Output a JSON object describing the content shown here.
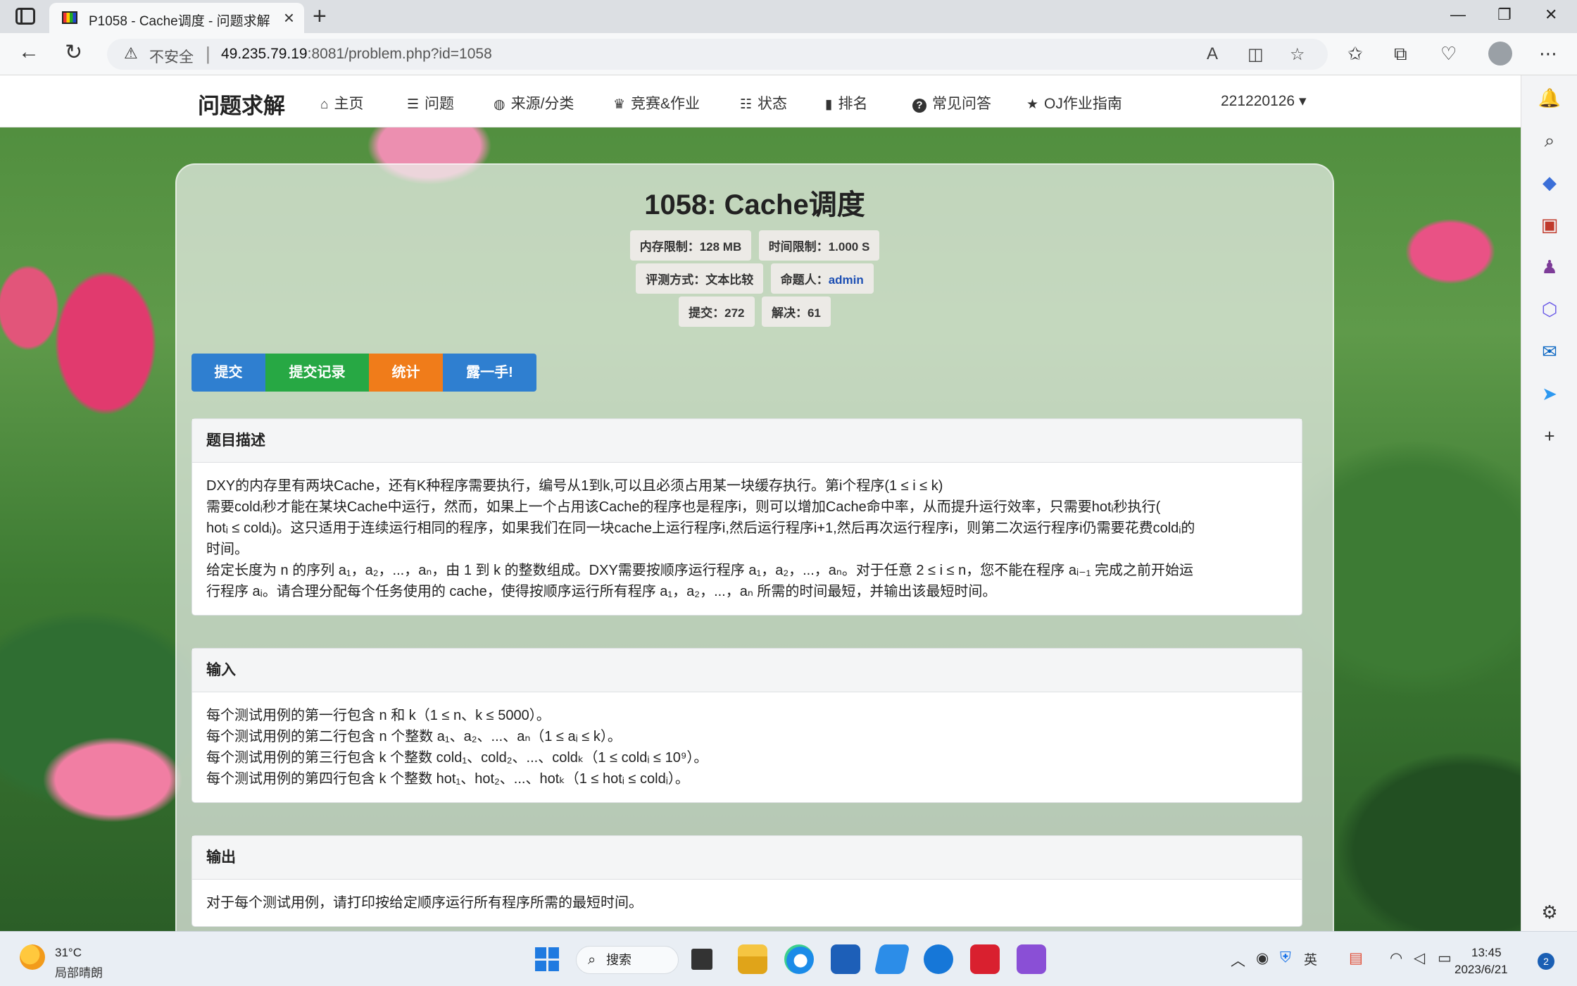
{
  "browser": {
    "tab_title": "P1058 - Cache调度 - 问题求解",
    "security_label": "不安全",
    "url_host": "49.235.79.19",
    "url_rest": ":8081/problem.php?id=1058"
  },
  "site": {
    "brand": "问题求解",
    "nav": [
      {
        "icon": "home-icon",
        "glyph": "⌂",
        "label": "主页"
      },
      {
        "icon": "list-icon",
        "glyph": "☰",
        "label": "问题"
      },
      {
        "icon": "globe-icon",
        "glyph": "◍",
        "label": "来源/分类"
      },
      {
        "icon": "trophy-icon",
        "glyph": "♛",
        "label": "竞赛&作业"
      },
      {
        "icon": "tasks-icon",
        "glyph": "☷",
        "label": "状态"
      },
      {
        "icon": "bar-chart-icon",
        "glyph": "▮",
        "label": "排名"
      },
      {
        "icon": "question-circle-icon",
        "glyph": "?",
        "label": "常见问答"
      },
      {
        "icon": "star-icon",
        "glyph": "★",
        "label": "OJ作业指南"
      }
    ],
    "user": "221220126"
  },
  "problem": {
    "title": "1058: Cache调度",
    "memory_limit": "内存限制：128 MB",
    "time_limit": "时间限制：1.000 S",
    "judge_mode": "评测方式：文本比较",
    "author_label": "命题人：",
    "author": "admin",
    "submissions": "提交：272",
    "solved": "解决：61",
    "buttons": {
      "submit": "提交",
      "records": "提交记录",
      "stats": "统计",
      "show": "露一手!"
    },
    "button_colors": {
      "submit": "#2f7fd0",
      "records": "#27a844",
      "stats": "#f07c1a",
      "show": "#2f7fd0"
    },
    "description_title": "题目描述",
    "description": [
      "DXY的内存里有两块Cache，还有K种程序需要执行，编号从1到k,可以且必须占用某一块缓存执行。第i个程序(1 ≤ i ≤ k)",
      "需要coldᵢ秒才能在某块Cache中运行，然而，如果上一个占用该Cache的程序也是程序i，则可以增加Cache命中率，从而提升运行效率，只需要hotᵢ秒执行(",
      "hotᵢ ≤ coldᵢ)。这只适用于连续运行相同的程序，如果我们在同一块cache上运行程序i,然后运行程序i+1,然后再次运行程序i，则第二次运行程序i仍需要花费coldᵢ的",
      "时间。",
      "给定长度为 n 的序列 a₁，a₂，...，aₙ，由 1 到 k 的整数组成。DXY需要按顺序运行程序 a₁，a₂，...，aₙ。对于任意 2 ≤ i ≤ n，您不能在程序 aᵢ₋₁ 完成之前开始运",
      "行程序 aᵢ。请合理分配每个任务使用的 cache，使得按顺序运行所有程序 a₁，a₂，...，aₙ 所需的时间最短，并输出该最短时间。"
    ],
    "input_title": "输入",
    "input": [
      "每个测试用例的第一行包含 n 和 k（1 ≤ n、k ≤ 5000）。",
      "每个测试用例的第二行包含 n 个整数 a₁、a₂、...、aₙ（1 ≤ aᵢ ≤ k）。",
      "每个测试用例的第三行包含 k 个整数 cold₁、cold₂、...、coldₖ（1 ≤ coldᵢ ≤ 10⁹）。",
      "每个测试用例的第四行包含 k 个整数 hot₁、hot₂、...、hotₖ（1 ≤ hotᵢ ≤ coldᵢ）。"
    ],
    "output_title": "输出",
    "output": "对于每个测试用例，请打印按给定顺序运行所有程序所需的最短时间。"
  },
  "taskbar": {
    "temperature": "31°C",
    "weather": "局部晴朗",
    "search": "搜索",
    "ime": "英",
    "time": "13:45",
    "date": "2023/6/21",
    "notifications": "2"
  }
}
